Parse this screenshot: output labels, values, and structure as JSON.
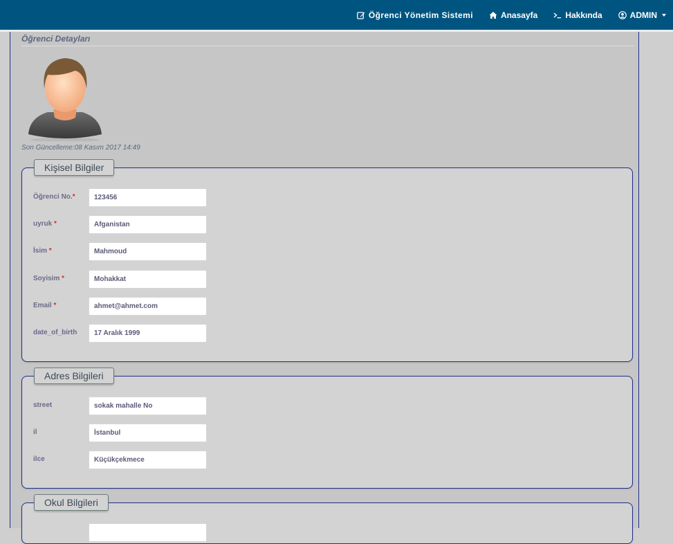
{
  "navbar": {
    "brand": "Öğrenci Yönetim Sistemi",
    "home": "Anasayfa",
    "about": "Hakkında",
    "user": "ADMIN"
  },
  "page": {
    "title": "Öğrenci Detayları",
    "last_update": "Son Güncelleme:08 Kasım 2017 14:49"
  },
  "personal": {
    "legend": "Kişisel Bilgiler",
    "fields": [
      {
        "label": "Öğrenci No.",
        "required": "*",
        "value": "123456"
      },
      {
        "label": "uyruk",
        "required": "*",
        "value": "Afganistan"
      },
      {
        "label": "İsim",
        "required": "*",
        "value": "Mahmoud"
      },
      {
        "label": "Soyisim",
        "required": "*",
        "value": "Mohakkat"
      },
      {
        "label": "Email",
        "required": "*",
        "value": "ahmet@ahmet.com"
      },
      {
        "label": "date_of_birth",
        "required": "",
        "value": "17 Aralık 1999"
      }
    ]
  },
  "address": {
    "legend": "Adres Bilgileri",
    "fields": [
      {
        "label": "street",
        "value": "sokak mahalle No"
      },
      {
        "label": "il",
        "value": "İstanbul"
      },
      {
        "label": "ilce",
        "value": "Küçükçekmece"
      }
    ]
  },
  "school": {
    "legend": "Okul Bilgileri"
  },
  "colors": {
    "navbar": "#005580",
    "content_bg": "#c6c6c6",
    "fieldset_bg": "#d3d3d3",
    "border": "#1f2f8a",
    "required": "#e0282b"
  },
  "icons": {
    "brand": "edit-icon",
    "home": "home-icon",
    "about": "terminal-icon",
    "user": "user-circle-icon"
  }
}
